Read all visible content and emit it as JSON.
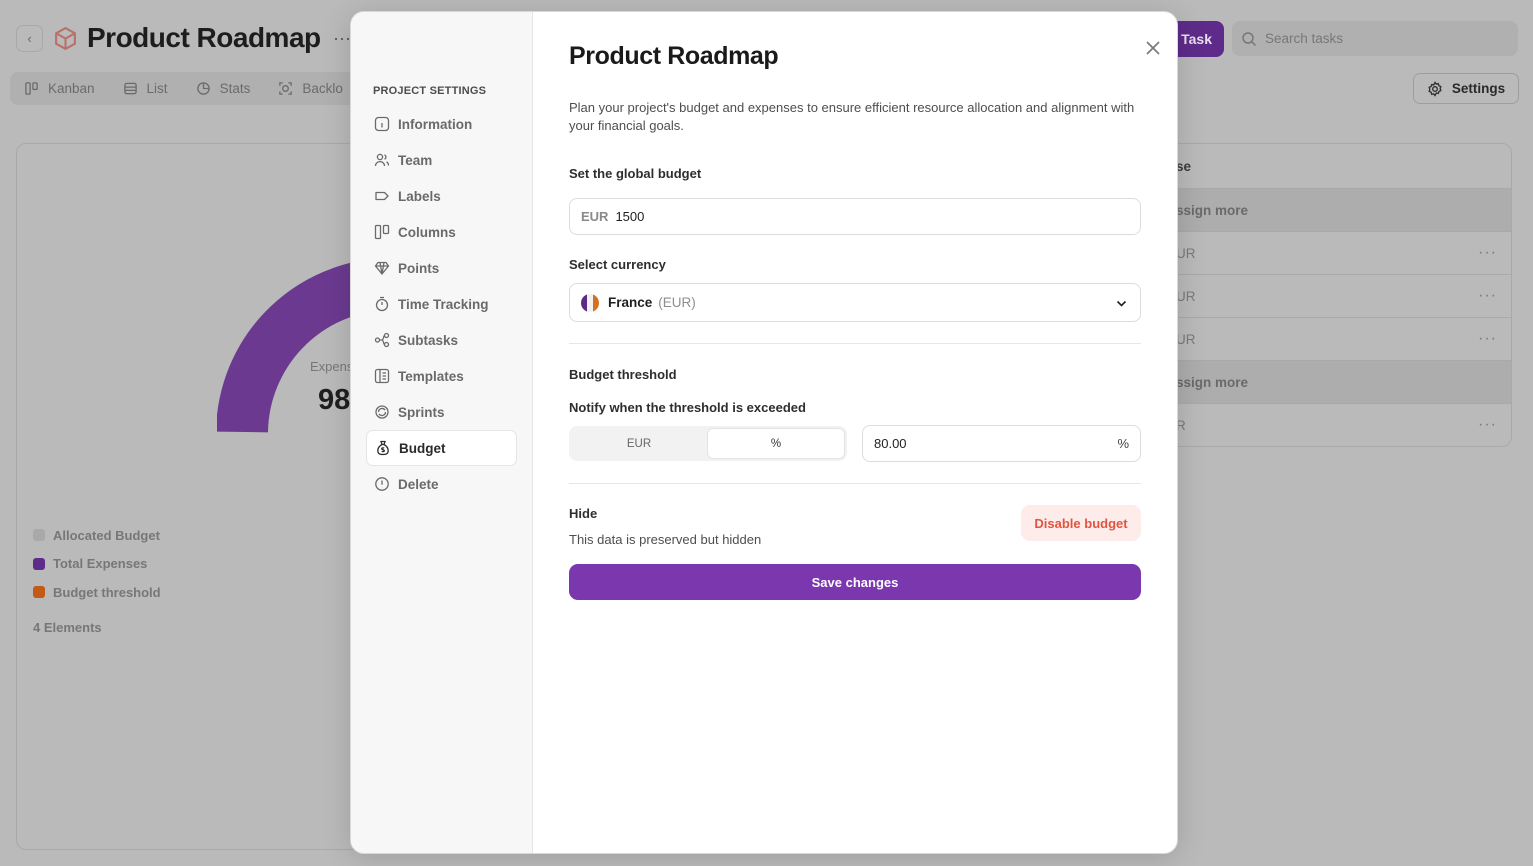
{
  "app": {
    "title": "Product Roadmap",
    "more_glyph": "···",
    "back_glyph": "‹",
    "tabs": [
      {
        "label": "Kanban",
        "icon": "kanban-icon"
      },
      {
        "label": "List",
        "icon": "list-icon"
      },
      {
        "label": "Stats",
        "icon": "stats-icon"
      },
      {
        "label": "Backlo",
        "icon": "backlog-icon"
      }
    ],
    "new_task_label": "Task",
    "search_placeholder": "Search tasks",
    "settings_label": "Settings",
    "stats": {
      "gauge_label": "Expens",
      "gauge_value": "98",
      "legend": [
        {
          "label": "Allocated Budget",
          "color": "#a9a9a9"
        },
        {
          "label": "Total Expenses",
          "color": "#5e2b8a"
        },
        {
          "label": "Budget threshold",
          "color": "#c55a17"
        }
      ],
      "elements_count": "4 Elements"
    },
    "expense_table": {
      "header": "se",
      "rows": [
        {
          "text": "ssign more",
          "type": "assign"
        },
        {
          "text": "UR",
          "type": "row"
        },
        {
          "text": "UR",
          "type": "row"
        },
        {
          "text": "UR",
          "type": "row"
        },
        {
          "text": "ssign more",
          "type": "assign"
        },
        {
          "text": "R",
          "type": "row"
        }
      ],
      "row_menu_glyph": "···"
    }
  },
  "modal": {
    "sidebar": {
      "heading": "PROJECT SETTINGS",
      "items": [
        {
          "label": "Information",
          "icon": "info-icon"
        },
        {
          "label": "Team",
          "icon": "team-icon"
        },
        {
          "label": "Labels",
          "icon": "label-icon"
        },
        {
          "label": "Columns",
          "icon": "columns-icon"
        },
        {
          "label": "Points",
          "icon": "points-icon"
        },
        {
          "label": "Time Tracking",
          "icon": "stopwatch-icon"
        },
        {
          "label": "Subtasks",
          "icon": "subtasks-icon"
        },
        {
          "label": "Templates",
          "icon": "templates-icon"
        },
        {
          "label": "Sprints",
          "icon": "sprints-icon"
        },
        {
          "label": "Budget",
          "icon": "money-bag-icon"
        },
        {
          "label": "Delete",
          "icon": "alert-icon"
        }
      ],
      "active_item": "Budget"
    },
    "title": "Product Roadmap",
    "description": "Plan your project's budget and expenses to ensure efficient resource allocation and alignment with your financial goals.",
    "global_budget": {
      "label": "Set the global budget",
      "prefix": "EUR",
      "value": "1500"
    },
    "currency": {
      "label": "Select currency",
      "country": "France",
      "code": "(EUR)",
      "flag_colors": [
        "#5b2a86",
        "#f1f1f1",
        "#d4711f"
      ]
    },
    "threshold": {
      "section_title": "Budget threshold",
      "notify_label": "Notify when the threshold is exceeded",
      "modes": [
        "EUR",
        "%"
      ],
      "active_mode": "%",
      "value": "80.00",
      "unit": "%"
    },
    "hide": {
      "title": "Hide",
      "description": "This data is preserved but hidden",
      "disable_label": "Disable budget"
    },
    "save_label": "Save changes",
    "colors": {
      "accent": "#7b37ad",
      "danger": "#e0553f",
      "danger_bg": "#fdecea"
    }
  }
}
